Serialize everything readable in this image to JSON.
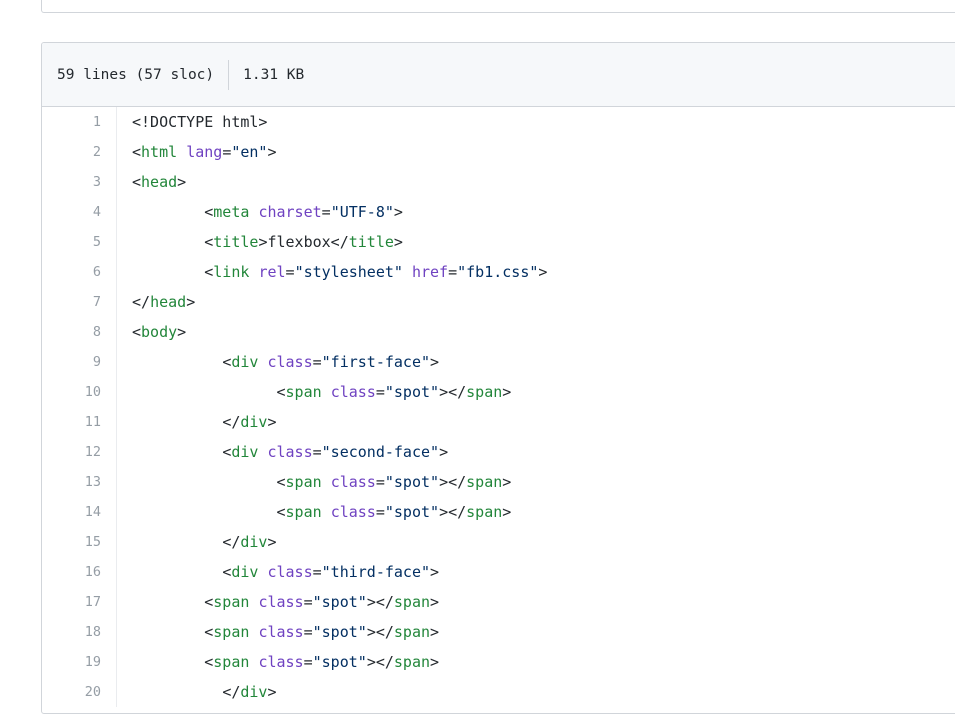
{
  "file_header": {
    "lines_info": "59 lines (57 sloc)",
    "size": "1.31 KB"
  },
  "code_lines": [
    {
      "num": "1",
      "indent": 0,
      "tokens": [
        [
          "p",
          "<!DOCTYPE html>"
        ]
      ]
    },
    {
      "num": "2",
      "indent": 0,
      "tokens": [
        [
          "p",
          "<"
        ],
        [
          "t",
          "html"
        ],
        [
          "p",
          " "
        ],
        [
          "a",
          "lang"
        ],
        [
          "p",
          "="
        ],
        [
          "s",
          "\"en\""
        ],
        [
          "p",
          ">"
        ]
      ]
    },
    {
      "num": "3",
      "indent": 0,
      "tokens": [
        [
          "p",
          "<"
        ],
        [
          "t",
          "head"
        ],
        [
          "p",
          ">"
        ]
      ]
    },
    {
      "num": "4",
      "indent": 8,
      "tokens": [
        [
          "p",
          "<"
        ],
        [
          "t",
          "meta"
        ],
        [
          "p",
          " "
        ],
        [
          "a",
          "charset"
        ],
        [
          "p",
          "="
        ],
        [
          "s",
          "\"UTF-8\""
        ],
        [
          "p",
          ">"
        ]
      ]
    },
    {
      "num": "5",
      "indent": 8,
      "tokens": [
        [
          "p",
          "<"
        ],
        [
          "t",
          "title"
        ],
        [
          "p",
          ">flexbox</"
        ],
        [
          "t",
          "title"
        ],
        [
          "p",
          ">"
        ]
      ]
    },
    {
      "num": "6",
      "indent": 8,
      "tokens": [
        [
          "p",
          "<"
        ],
        [
          "t",
          "link"
        ],
        [
          "p",
          " "
        ],
        [
          "a",
          "rel"
        ],
        [
          "p",
          "="
        ],
        [
          "s",
          "\"stylesheet\""
        ],
        [
          "p",
          " "
        ],
        [
          "a",
          "href"
        ],
        [
          "p",
          "="
        ],
        [
          "s",
          "\"fb1.css\""
        ],
        [
          "p",
          ">"
        ]
      ]
    },
    {
      "num": "7",
      "indent": 0,
      "tokens": [
        [
          "p",
          "</"
        ],
        [
          "t",
          "head"
        ],
        [
          "p",
          ">"
        ]
      ]
    },
    {
      "num": "8",
      "indent": 0,
      "tokens": [
        [
          "p",
          "<"
        ],
        [
          "t",
          "body"
        ],
        [
          "p",
          ">"
        ]
      ]
    },
    {
      "num": "9",
      "indent": 10,
      "tokens": [
        [
          "p",
          "<"
        ],
        [
          "t",
          "div"
        ],
        [
          "p",
          " "
        ],
        [
          "a",
          "class"
        ],
        [
          "p",
          "="
        ],
        [
          "s",
          "\"first-face\""
        ],
        [
          "p",
          ">"
        ]
      ]
    },
    {
      "num": "10",
      "indent": 16,
      "tokens": [
        [
          "p",
          "<"
        ],
        [
          "t",
          "span"
        ],
        [
          "p",
          " "
        ],
        [
          "a",
          "class"
        ],
        [
          "p",
          "="
        ],
        [
          "s",
          "\"spot\""
        ],
        [
          "p",
          "></"
        ],
        [
          "t",
          "span"
        ],
        [
          "p",
          ">"
        ]
      ]
    },
    {
      "num": "11",
      "indent": 10,
      "tokens": [
        [
          "p",
          "</"
        ],
        [
          "t",
          "div"
        ],
        [
          "p",
          ">"
        ]
      ]
    },
    {
      "num": "12",
      "indent": 10,
      "tokens": [
        [
          "p",
          "<"
        ],
        [
          "t",
          "div"
        ],
        [
          "p",
          " "
        ],
        [
          "a",
          "class"
        ],
        [
          "p",
          "="
        ],
        [
          "s",
          "\"second-face\""
        ],
        [
          "p",
          ">"
        ]
      ]
    },
    {
      "num": "13",
      "indent": 16,
      "tokens": [
        [
          "p",
          "<"
        ],
        [
          "t",
          "span"
        ],
        [
          "p",
          " "
        ],
        [
          "a",
          "class"
        ],
        [
          "p",
          "="
        ],
        [
          "s",
          "\"spot\""
        ],
        [
          "p",
          "></"
        ],
        [
          "t",
          "span"
        ],
        [
          "p",
          ">"
        ]
      ]
    },
    {
      "num": "14",
      "indent": 16,
      "tokens": [
        [
          "p",
          "<"
        ],
        [
          "t",
          "span"
        ],
        [
          "p",
          " "
        ],
        [
          "a",
          "class"
        ],
        [
          "p",
          "="
        ],
        [
          "s",
          "\"spot\""
        ],
        [
          "p",
          "></"
        ],
        [
          "t",
          "span"
        ],
        [
          "p",
          ">"
        ]
      ]
    },
    {
      "num": "15",
      "indent": 10,
      "tokens": [
        [
          "p",
          "</"
        ],
        [
          "t",
          "div"
        ],
        [
          "p",
          ">"
        ]
      ]
    },
    {
      "num": "16",
      "indent": 10,
      "tokens": [
        [
          "p",
          "<"
        ],
        [
          "t",
          "div"
        ],
        [
          "p",
          " "
        ],
        [
          "a",
          "class"
        ],
        [
          "p",
          "="
        ],
        [
          "s",
          "\"third-face\""
        ],
        [
          "p",
          ">"
        ]
      ]
    },
    {
      "num": "17",
      "indent": 8,
      "tokens": [
        [
          "p",
          "<"
        ],
        [
          "t",
          "span"
        ],
        [
          "p",
          " "
        ],
        [
          "a",
          "class"
        ],
        [
          "p",
          "="
        ],
        [
          "s",
          "\"spot\""
        ],
        [
          "p",
          "></"
        ],
        [
          "t",
          "span"
        ],
        [
          "p",
          ">"
        ]
      ]
    },
    {
      "num": "18",
      "indent": 8,
      "tokens": [
        [
          "p",
          "<"
        ],
        [
          "t",
          "span"
        ],
        [
          "p",
          " "
        ],
        [
          "a",
          "class"
        ],
        [
          "p",
          "="
        ],
        [
          "s",
          "\"spot\""
        ],
        [
          "p",
          "></"
        ],
        [
          "t",
          "span"
        ],
        [
          "p",
          ">"
        ]
      ]
    },
    {
      "num": "19",
      "indent": 8,
      "tokens": [
        [
          "p",
          "<"
        ],
        [
          "t",
          "span"
        ],
        [
          "p",
          " "
        ],
        [
          "a",
          "class"
        ],
        [
          "p",
          "="
        ],
        [
          "s",
          "\"spot\""
        ],
        [
          "p",
          "></"
        ],
        [
          "t",
          "span"
        ],
        [
          "p",
          ">"
        ]
      ]
    },
    {
      "num": "20",
      "indent": 10,
      "tokens": [
        [
          "p",
          "</"
        ],
        [
          "t",
          "div"
        ],
        [
          "p",
          ">"
        ]
      ]
    }
  ],
  "colors": {
    "tag": "#22863a",
    "attr": "#6f42c1",
    "string": "#032f62",
    "plain": "#24292e",
    "line_number": "#959da5"
  }
}
